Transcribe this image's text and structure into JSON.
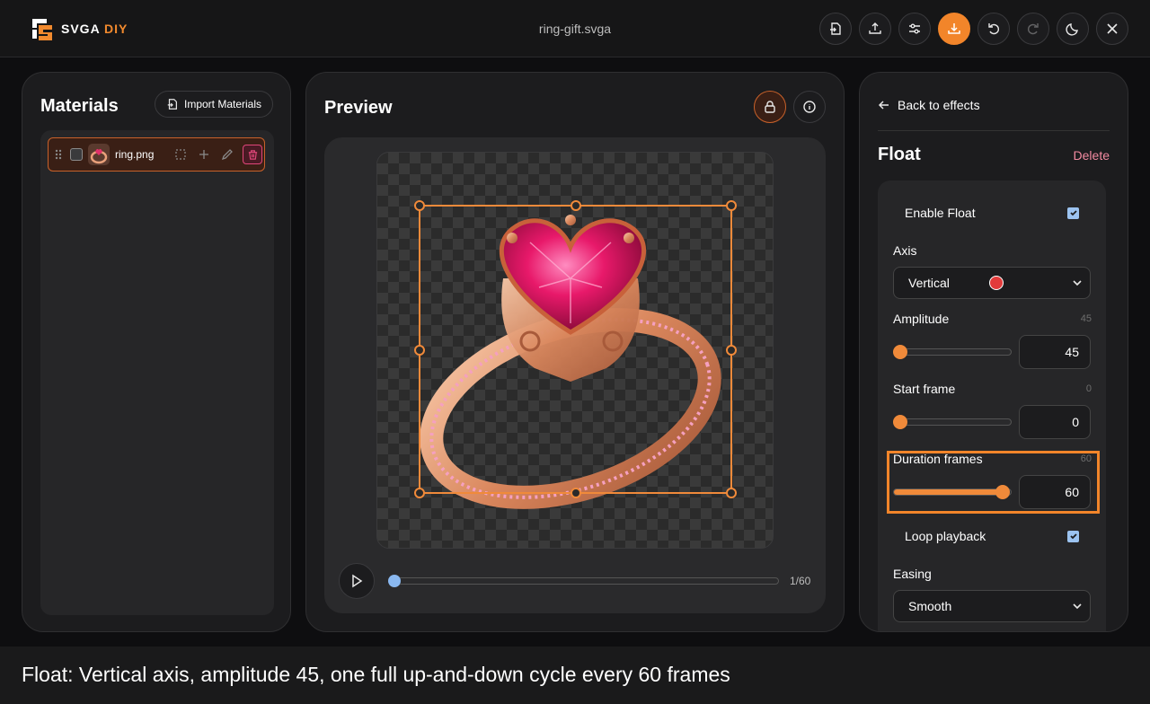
{
  "app": {
    "logo_text": "SVGA",
    "logo_accent": "DIY",
    "file_title": "ring-gift.svga",
    "accent_color": "#f2852a"
  },
  "toolbar": {
    "buttons": [
      {
        "icon": "file-import-icon"
      },
      {
        "icon": "upload-icon"
      },
      {
        "icon": "sliders-icon"
      },
      {
        "icon": "download-icon"
      },
      {
        "icon": "undo-icon"
      },
      {
        "icon": "redo-icon"
      },
      {
        "icon": "moon-icon"
      },
      {
        "icon": "close-icon"
      }
    ]
  },
  "materials": {
    "title": "Materials",
    "import_label": "Import Materials",
    "items": [
      {
        "name": "ring.png",
        "selected": true
      }
    ]
  },
  "preview": {
    "title": "Preview",
    "frame_counter": "1/60"
  },
  "effects": {
    "back_label": "Back to effects",
    "effect_title": "Float",
    "delete_label": "Delete",
    "enable_label": "Enable Float",
    "enable_checked": true,
    "axis_label": "Axis",
    "axis_value": "Vertical",
    "axis_color": "#e23b3b",
    "amplitude_label": "Amplitude",
    "amplitude_hint": "45",
    "amplitude_value": "45",
    "amplitude_fraction": 0.0,
    "start_label": "Start frame",
    "start_hint": "0",
    "start_value": "0",
    "start_fraction": 0.0,
    "duration_label": "Duration frames",
    "duration_hint": "60",
    "duration_value": "60",
    "duration_fraction": 1.0,
    "loop_label": "Loop playback",
    "loop_checked": true,
    "easing_label": "Easing",
    "easing_value": "Smooth"
  },
  "caption": {
    "text": "Float: Vertical axis, amplitude 45, one full up-and-down cycle every 60 frames"
  }
}
